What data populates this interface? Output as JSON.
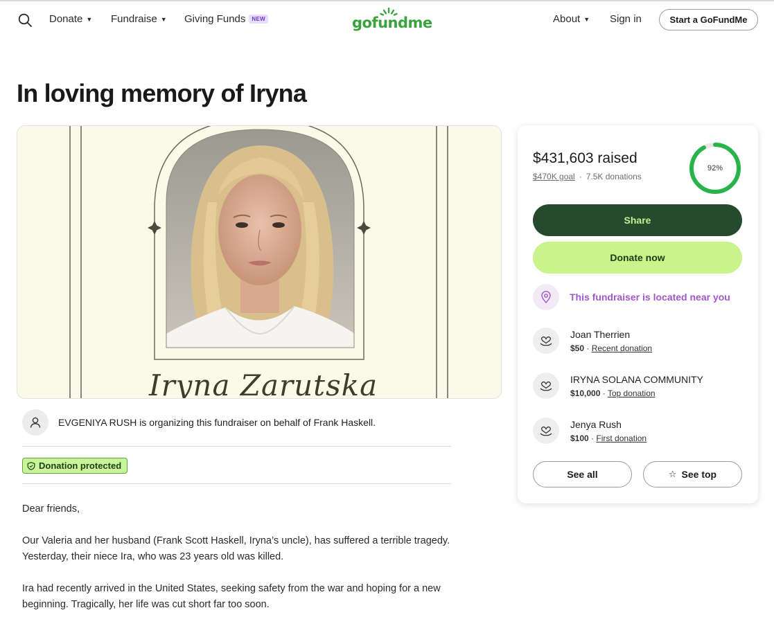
{
  "header": {
    "nav_left": [
      {
        "label": "Donate",
        "has_caret": true
      },
      {
        "label": "Fundraise",
        "has_caret": true
      },
      {
        "label": "Giving Funds",
        "badge": "NEW"
      }
    ],
    "logo_text": "gofundme",
    "nav_right": [
      {
        "label": "About",
        "has_caret": true
      },
      {
        "label": "Sign in"
      }
    ],
    "start_button": "Start a GoFundMe"
  },
  "page": {
    "title": "In loving memory of Iryna",
    "hero_name": "Iryna Zarutska"
  },
  "organizer": {
    "text": "EVGENIYA RUSH is organizing this fundraiser on behalf of Frank Haskell."
  },
  "protection_badge": "Donation protected",
  "story": {
    "paragraphs": [
      "Dear friends,",
      "Our Valeria and her husband (Frank Scott Haskell, Iryna’s uncle), has suffered a terrible tragedy. Yesterday, their niece Ira, who was 23 years old was killed.",
      "Ira had recently arrived in the United States, seeking safety from the war and hoping for a new beginning. Tragically, her life was cut short far too soon."
    ]
  },
  "sidebar": {
    "raised": "$431,603 raised",
    "goal": "$470K goal",
    "separator": "·",
    "donations": "7.5K donations",
    "progress_percent": 92,
    "progress_label": "92%",
    "share_label": "Share",
    "donate_label": "Donate now",
    "near_text": "This fundraiser is located near you",
    "donors": [
      {
        "name": "Joan Therrien",
        "amount": "$50",
        "sep": " · ",
        "tag": "Recent donation"
      },
      {
        "name": "IRYNA SOLANA COMMUNITY",
        "amount": "$10,000",
        "sep": " · ",
        "tag": "Top donation"
      },
      {
        "name": "Jenya Rush",
        "amount": "$100",
        "sep": " · ",
        "tag": "First donation"
      }
    ],
    "see_all_label": "See all",
    "see_top_label": "See top",
    "colors": {
      "accent_green": "#2ab34a",
      "dark_green": "#274a2f",
      "lime": "#c9f48c",
      "purple": "#a256c9"
    }
  }
}
